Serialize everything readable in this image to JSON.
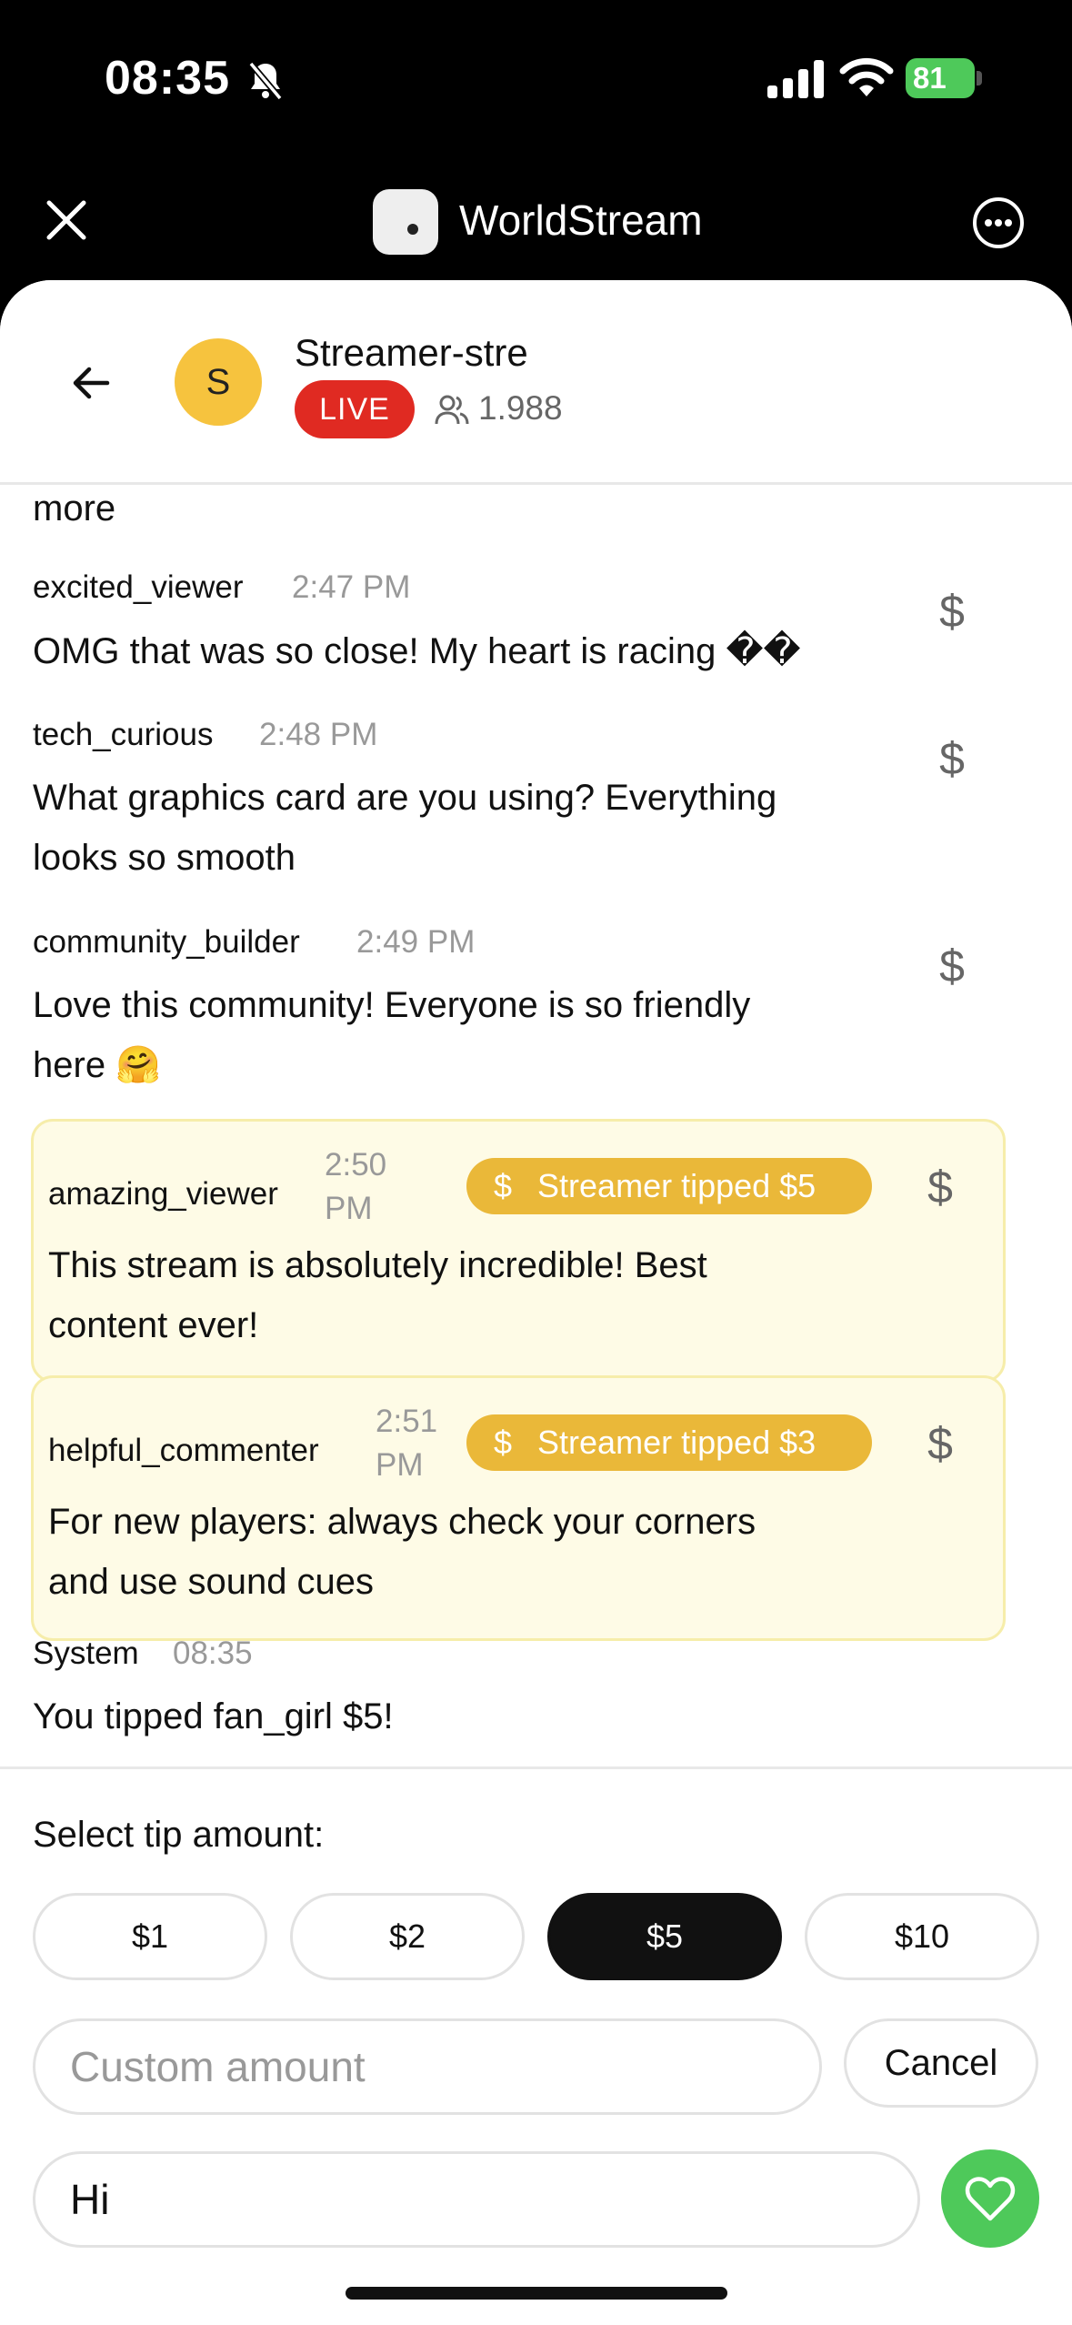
{
  "status_bar": {
    "time": "08:35",
    "battery": "81"
  },
  "app": {
    "title": "WorldStream"
  },
  "stream": {
    "streamer_name": "Streamer-stre",
    "avatar_initial": "S",
    "live_label": "LIVE",
    "viewer_count": "1.988"
  },
  "chat": {
    "truncated_text": "more",
    "messages": [
      {
        "user": "excited_viewer",
        "time": "2:47 PM",
        "lines": [
          "OMG that was so close! My heart is racing ��"
        ],
        "tip_icon": "$"
      },
      {
        "user": "tech_curious",
        "time": "2:48 PM",
        "lines": [
          "What graphics card are you using? Everything",
          "looks so smooth"
        ],
        "tip_icon": "$"
      },
      {
        "user": "community_builder",
        "time": "2:49 PM",
        "lines": [
          "Love this community! Everyone is so friendly",
          "here 🤗"
        ],
        "tip_icon": "$"
      },
      {
        "user": "amazing_viewer",
        "time_lines": [
          "2:50",
          "PM"
        ],
        "badge_icon": "$",
        "badge": "Streamer tipped $5",
        "lines": [
          "This stream is absolutely incredible! Best",
          "content ever!"
        ],
        "tip_icon": "$"
      },
      {
        "user": "helpful_commenter",
        "time_lines": [
          "2:51",
          "PM"
        ],
        "badge_icon": "$",
        "badge": "Streamer tipped $3",
        "lines": [
          "For new players: always check your corners",
          "and use sound cues"
        ],
        "tip_icon": "$"
      },
      {
        "user": "System",
        "time": "08:35",
        "lines": [
          "You tipped fan_girl $5!"
        ]
      }
    ]
  },
  "tip_panel": {
    "heading": "Select tip amount:",
    "amounts": [
      "$1",
      "$2",
      "$5",
      "$10"
    ],
    "selected": "$5",
    "custom_placeholder": "Custom amount",
    "cancel_label": "Cancel",
    "message_value": "Hi"
  },
  "colors": {
    "accent_tip": "#eab839",
    "live": "#e02a22",
    "send": "#4ec95a",
    "avatar": "#f6c33e"
  },
  "icons": {
    "close": "close-icon",
    "more": "more-icon",
    "back": "back-arrow-icon",
    "send": "heart-icon",
    "viewers": "people-icon"
  }
}
